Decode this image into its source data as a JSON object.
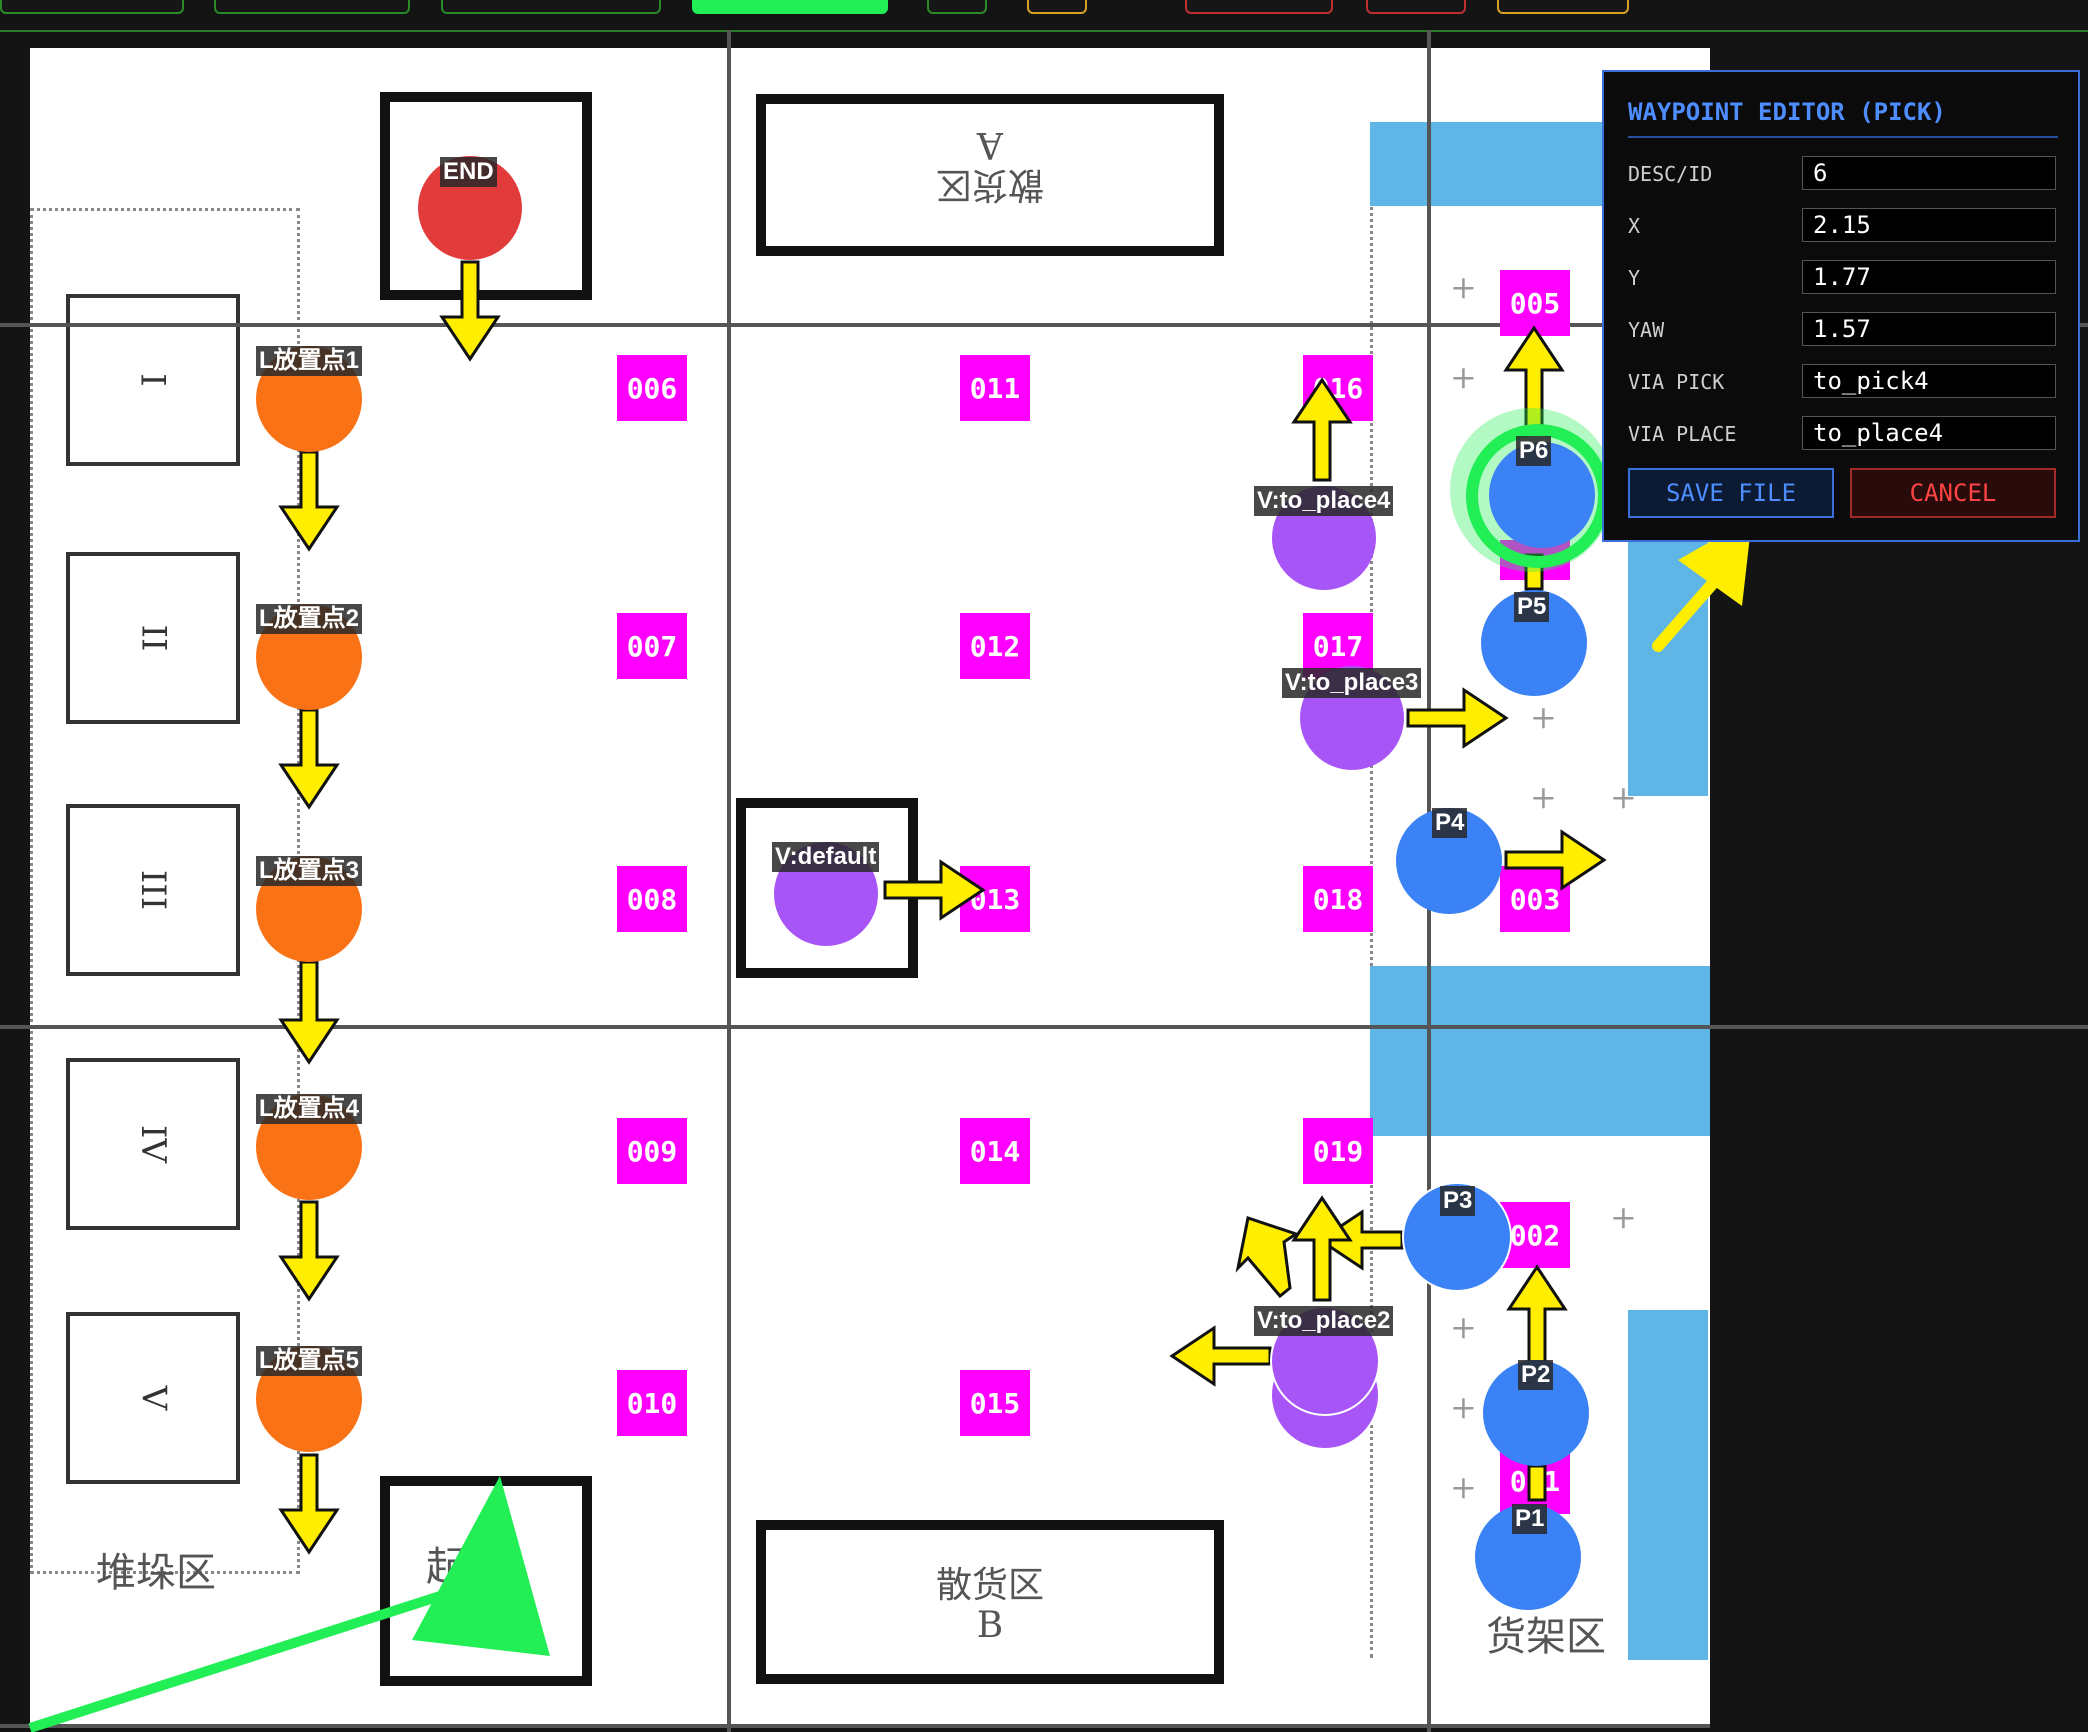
{
  "editor": {
    "title": "WAYPOINT EDITOR (PICK)",
    "fields": [
      {
        "label": "DESC/ID",
        "value": "6"
      },
      {
        "label": "X",
        "value": "2.15"
      },
      {
        "label": "Y",
        "value": "1.77"
      },
      {
        "label": "YAW",
        "value": "1.57"
      },
      {
        "label": "VIA PICK",
        "value": "to_pick4"
      },
      {
        "label": "VIA PLACE",
        "value": "to_place4"
      }
    ],
    "save_label": "SAVE FILE",
    "cancel_label": "CANCEL"
  },
  "map": {
    "zone_labels": {
      "stack_area": "堆垛区",
      "shelf_area": "货架区",
      "bulk_b_line1": "散货区",
      "bulk_b_line2": "B",
      "bulk_a_line1": "散货区",
      "bulk_a_line2": "A",
      "start_area": "起"
    },
    "slot_labels": [
      "I",
      "II",
      "III",
      "IV",
      "V"
    ],
    "markers": [
      "006",
      "007",
      "008",
      "009",
      "010",
      "011",
      "012",
      "013",
      "014",
      "015",
      "016",
      "017",
      "018",
      "019",
      "005",
      "003",
      "002",
      "001"
    ],
    "place_points": [
      "L放置点1",
      "L放置点2",
      "L放置点3",
      "L放置点4",
      "L放置点5"
    ],
    "end_label": "END",
    "via_points": [
      "V:to_place4",
      "V:to_place3",
      "V:default",
      "V:to_place2"
    ],
    "pick_points": [
      "P6",
      "P5",
      "P4",
      "P3",
      "P2",
      "P1"
    ]
  },
  "colors": {
    "place": "#f97316",
    "via": "#a855f7",
    "pick": "#3b82f6",
    "end": "#e23b3b",
    "marker": "#ff00ff",
    "arrow": "#ffee00",
    "selection": "#22ee55",
    "accent_blue": "#4d8dff",
    "cancel_red": "#ff4444"
  }
}
